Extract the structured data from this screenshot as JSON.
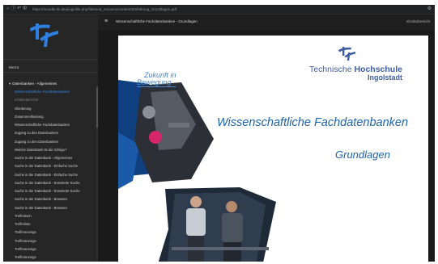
{
  "browser": {
    "url": "https://moodle.thi.de/pluginfile.php/file/mod_resource/content/Einführung_Grundlagen.pdf",
    "controls": "○ ⓘ ↶ ⊕"
  },
  "sidebar": {
    "menu_title": "Menü",
    "course": "Datenbanken - Allgemeines",
    "items": [
      {
        "label": "Wissenschaftliche Fachdatenbanken",
        "state": "active"
      },
      {
        "label": "Inhaltsübersicht",
        "state": "muted"
      },
      {
        "label": "Gliederung",
        "state": "normal"
      },
      {
        "label": "Zusammenfassung",
        "state": "normal"
      },
      {
        "label": "Wissenschaftliche Fachdatenbanken",
        "state": "normal"
      },
      {
        "label": "Zugang zu den Datenbanken",
        "state": "normal"
      },
      {
        "label": "Zugang zu den Datenbanken",
        "state": "normal"
      },
      {
        "label": "Welche Datenbank ist die richtige?",
        "state": "normal"
      },
      {
        "label": "Suche in der Datenbank - Allgemeines",
        "state": "normal"
      },
      {
        "label": "Suche in der Datenbank - Einfache Suche",
        "state": "normal"
      },
      {
        "label": "Suche in der Datenbank - Einfache Suche",
        "state": "normal"
      },
      {
        "label": "Suche in der Datenbank - Erweiterte Suche",
        "state": "normal"
      },
      {
        "label": "Suche in der Datenbank - Erweiterte Suche",
        "state": "normal"
      },
      {
        "label": "Suche in der Datenbank - Browsen",
        "state": "normal"
      },
      {
        "label": "Suche in der Datenbank - Browsen",
        "state": "normal"
      },
      {
        "label": "Treffertisch",
        "state": "normal"
      },
      {
        "label": "Trefferliste",
        "state": "normal"
      },
      {
        "label": "Trefferanzeige",
        "state": "normal"
      },
      {
        "label": "Trefferanzeige",
        "state": "normal"
      },
      {
        "label": "Trefferanzeige",
        "state": "normal"
      },
      {
        "label": "Trefferanzeige",
        "state": "normal"
      },
      {
        "label": "Trefferanzeige",
        "state": "normal"
      }
    ]
  },
  "header": {
    "menu_icon": "hamburger-icon",
    "title": "Wissenschaftliche Fachdatenbanken - Grundlagen",
    "right_label": "Inhaltsübersicht"
  },
  "slide": {
    "org_line1_light": "Technische ",
    "org_line1_bold": "Hochschule",
    "org_line2": "Ingolstadt",
    "slogan_line1": "Zukunft in",
    "slogan_line2": "Bewegung",
    "title": "Wissenschaftliche Fachdatenbanken",
    "subtitle": "Grundlagen"
  },
  "colors": {
    "sidebar_bg": "#262626",
    "active_item": "#2f86f0",
    "logo_blue": "#3e5ea4",
    "title_blue": "#1e64a8"
  }
}
